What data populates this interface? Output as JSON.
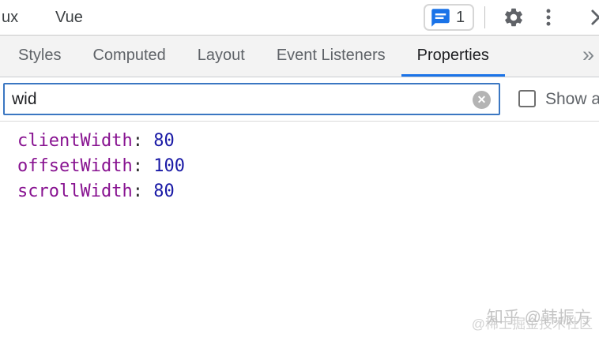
{
  "toolbar": {
    "tabs": [
      {
        "label": "ux"
      },
      {
        "label": "Vue"
      }
    ],
    "issues": {
      "count": "1"
    }
  },
  "subtabs": {
    "items": [
      {
        "label": "Styles",
        "active": false
      },
      {
        "label": "Computed",
        "active": false
      },
      {
        "label": "Layout",
        "active": false
      },
      {
        "label": "Event Listeners",
        "active": false
      },
      {
        "label": "Properties",
        "active": true
      }
    ],
    "overflow_chevron": "»"
  },
  "filter": {
    "value": "wid",
    "clear_icon": "✕",
    "show_all_label": "Show all",
    "show_all_checked": false
  },
  "property_list": {
    "separator": ":",
    "items": [
      {
        "name": "clientWidth",
        "value": "80"
      },
      {
        "name": "offsetWidth",
        "value": "100"
      },
      {
        "name": "scrollWidth",
        "value": "80"
      }
    ]
  },
  "watermark": {
    "primary": "知乎 @韩振方",
    "secondary": "@稀土掘金技术社区"
  },
  "colors": {
    "accent_blue": "#1a73e8",
    "active_tab_underline": "#1a73e8",
    "property_name": "#881391",
    "property_value": "#1a1aa6",
    "input_focus_border": "#3b77c2",
    "tab_bar_background": "#f3f3f3"
  }
}
